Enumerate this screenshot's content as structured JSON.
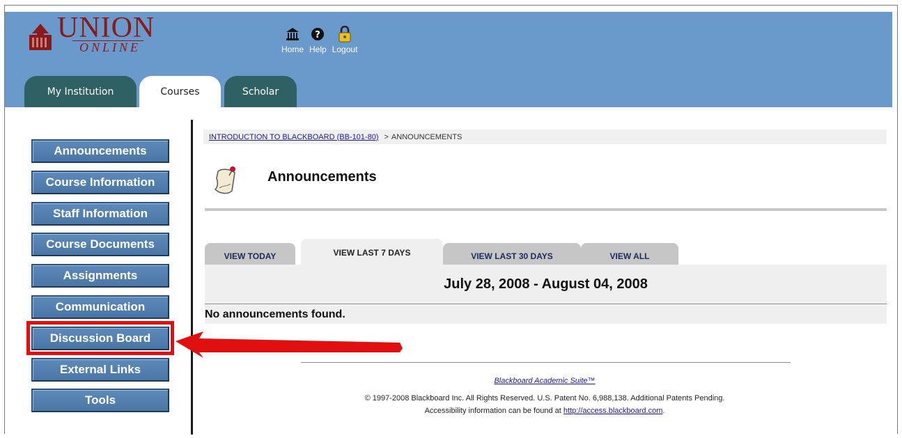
{
  "brand": {
    "union": "UNION",
    "online": "ONLINE",
    "color": "#8b1a1a"
  },
  "toplinks": [
    {
      "label": "Home",
      "icon": "home-icon"
    },
    {
      "label": "Help",
      "icon": "help-icon"
    },
    {
      "label": "Logout",
      "icon": "lock-icon"
    }
  ],
  "tabs": [
    {
      "label": "My Institution",
      "active": false
    },
    {
      "label": "Courses",
      "active": true
    },
    {
      "label": "Scholar",
      "active": false
    }
  ],
  "nav": [
    "Announcements",
    "Course Information",
    "Staff Information",
    "Course Documents",
    "Assignments",
    "Communication",
    "Discussion Board",
    "External Links",
    "Tools"
  ],
  "breadcrumb": {
    "course_link": "INTRODUCTION TO BLACKBOARD (BB-101-80)",
    "separator": ">",
    "current": "ANNOUNCEMENTS"
  },
  "page_title": "Announcements",
  "view_tabs": [
    {
      "label": "VIEW TODAY",
      "active": false
    },
    {
      "label": "VIEW LAST 7 DAYS",
      "active": true
    },
    {
      "label": "VIEW LAST 30 DAYS",
      "active": false
    },
    {
      "label": "VIEW ALL",
      "active": false
    }
  ],
  "date_range": "July 28, 2008 - August 04, 2008",
  "empty_message": "No announcements found.",
  "footer": {
    "suite_link": "Blackboard Academic Suite™",
    "copyright": "© 1997-2008 Blackboard Inc. All Rights Reserved. U.S. Patent No. 6,988,138. Additional Patents Pending.",
    "accessibility_prefix": "Accessibility information can be found at",
    "accessibility_link": "http://access.blackboard.com",
    "accessibility_suffix": "."
  },
  "colors": {
    "topbar": "#6a9acb",
    "tab_dark": "#2f6063",
    "nav_button": "#4a76a4",
    "highlight": "#e01010"
  }
}
